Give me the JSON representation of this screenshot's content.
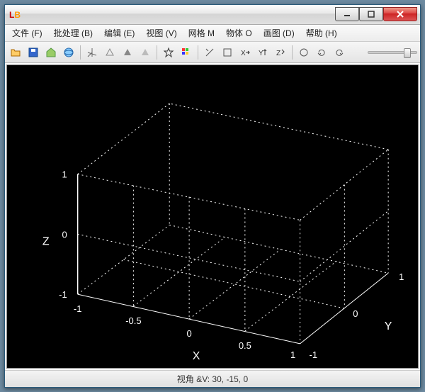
{
  "window": {
    "title": ""
  },
  "menu": {
    "items": [
      "文件 (F)",
      "批处理 (B)",
      "编辑 (E)",
      "视图 (V)",
      "网格 M",
      "物体 O",
      "画图 (D)",
      "帮助 (H)"
    ]
  },
  "status": {
    "text": "视角 &V: 30, -15, 0"
  },
  "axes": {
    "x": {
      "label": "X",
      "ticks": [
        "-1",
        "-0.5",
        "0",
        "0.5",
        "1"
      ]
    },
    "y": {
      "label": "Y",
      "ticks": [
        "1",
        "0",
        "-1"
      ]
    },
    "z": {
      "label": "Z",
      "ticks": [
        "1",
        "0",
        "-1"
      ]
    }
  },
  "view": {
    "elevation": 30,
    "azimuth": -15,
    "roll": 0
  }
}
